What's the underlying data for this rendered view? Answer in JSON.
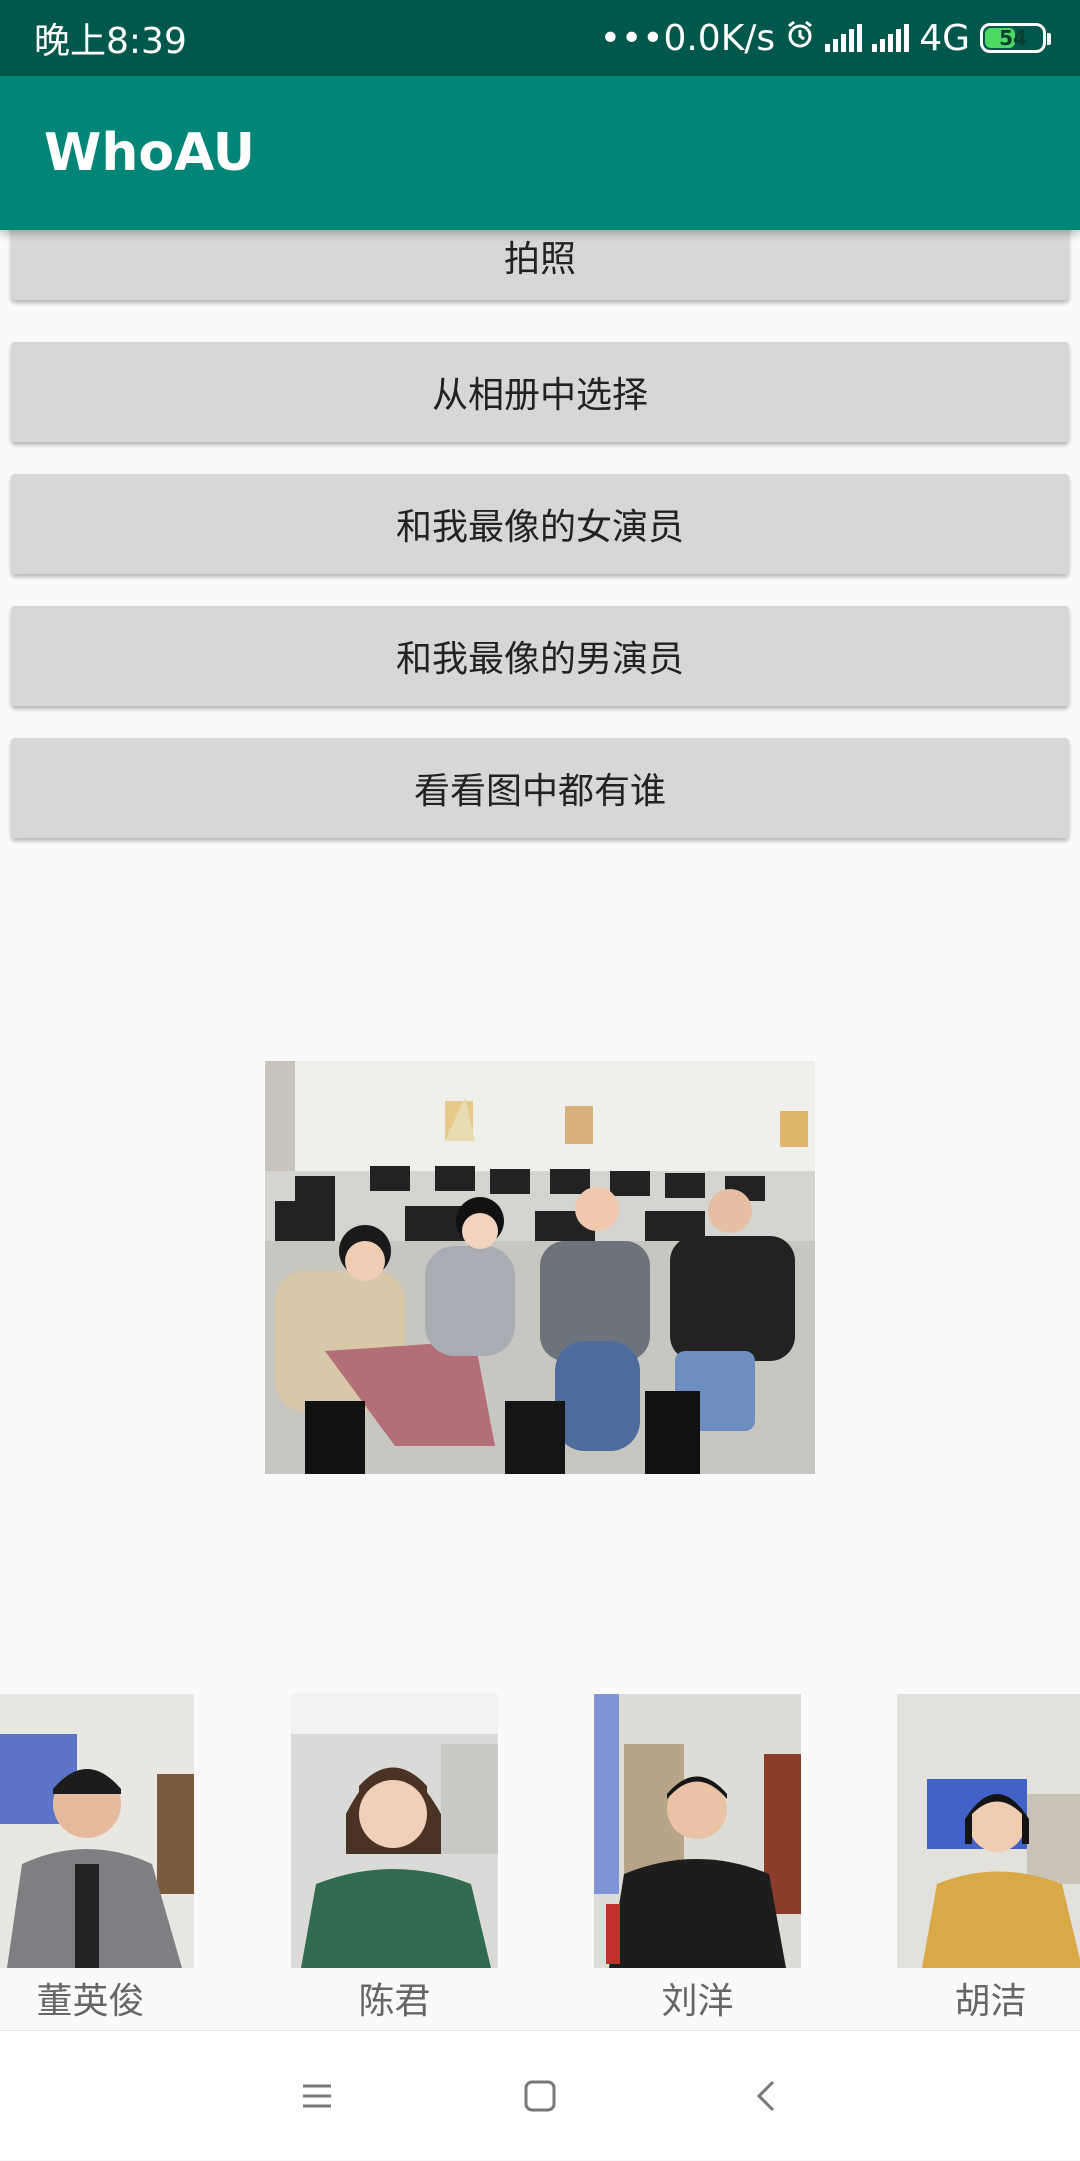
{
  "status_bar": {
    "time": "晚上8:39",
    "network_speed": "•••0.0K/s",
    "network_type": "4G",
    "battery_level": "54",
    "icons": [
      "alarm-icon",
      "signal-icon",
      "signal-icon",
      "battery-icon"
    ]
  },
  "app_bar": {
    "title": "WhoAU"
  },
  "buttons": [
    {
      "label": "拍照"
    },
    {
      "label": "从相册中选择"
    },
    {
      "label": "和我最像的女演员"
    },
    {
      "label": "和我最像的男演员"
    },
    {
      "label": "看看图中都有谁"
    }
  ],
  "faces": [
    {
      "name": "董英俊"
    },
    {
      "name": "陈君"
    },
    {
      "name": "刘洋"
    },
    {
      "name": "胡洁"
    }
  ],
  "nav_bar": {
    "icons": [
      "menu-icon",
      "home-icon",
      "back-icon"
    ]
  },
  "colors": {
    "status_bar": "#00574b",
    "app_bar": "#008577",
    "button_bg": "#d6d7d7",
    "background": "#fafafa"
  }
}
